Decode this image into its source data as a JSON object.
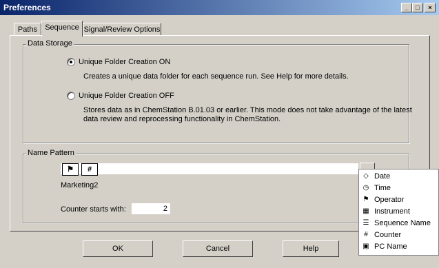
{
  "window": {
    "title": "Preferences",
    "controls": {
      "minimize": "_",
      "maximize": "□",
      "close": "×"
    }
  },
  "tabs": [
    "Paths",
    "Sequence",
    "Signal/Review Options"
  ],
  "active_tab": "Sequence",
  "data_storage": {
    "legend": "Data Storage",
    "option_on": {
      "label": "Unique Folder Creation ON",
      "selected": true,
      "description": "Creates a unique data folder for each sequence run. See Help for more details."
    },
    "option_off": {
      "label": "Unique Folder Creation OFF",
      "selected": false,
      "description_line1": "Stores data as in ChemStation B.01.03 or earlier. This mode does not take advantage of the latest",
      "description_line2": "data review and reprocessing functionality in ChemStation."
    }
  },
  "name_pattern": {
    "legend": "Name Pattern",
    "tokens": [
      {
        "icon": "operator-icon",
        "glyph": "⚑"
      },
      {
        "icon": "counter-icon",
        "glyph": "#"
      }
    ],
    "preview": "Marketing2",
    "counter_label": "Counter starts with:",
    "counter_value": "2"
  },
  "token_menu": {
    "items": [
      {
        "label": "Date",
        "icon": "date-icon",
        "glyph": "◇"
      },
      {
        "label": "Time",
        "icon": "clock-icon",
        "glyph": "◷"
      },
      {
        "label": "Operator",
        "icon": "operator-icon",
        "glyph": "⚑"
      },
      {
        "label": "Instrument",
        "icon": "instrument-icon",
        "glyph": "▦"
      },
      {
        "label": "Sequence Name",
        "icon": "sequence-icon",
        "glyph": "☰"
      },
      {
        "label": "Counter",
        "icon": "counter-icon",
        "glyph": "#"
      },
      {
        "label": "PC Name",
        "icon": "pc-icon",
        "glyph": "▣"
      }
    ]
  },
  "buttons": {
    "ok": "OK",
    "cancel": "Cancel",
    "help": "Help"
  },
  "colors": {
    "titlebar_start": "#0a246a",
    "titlebar_end": "#a6caf0",
    "face": "#d4d0c8"
  }
}
